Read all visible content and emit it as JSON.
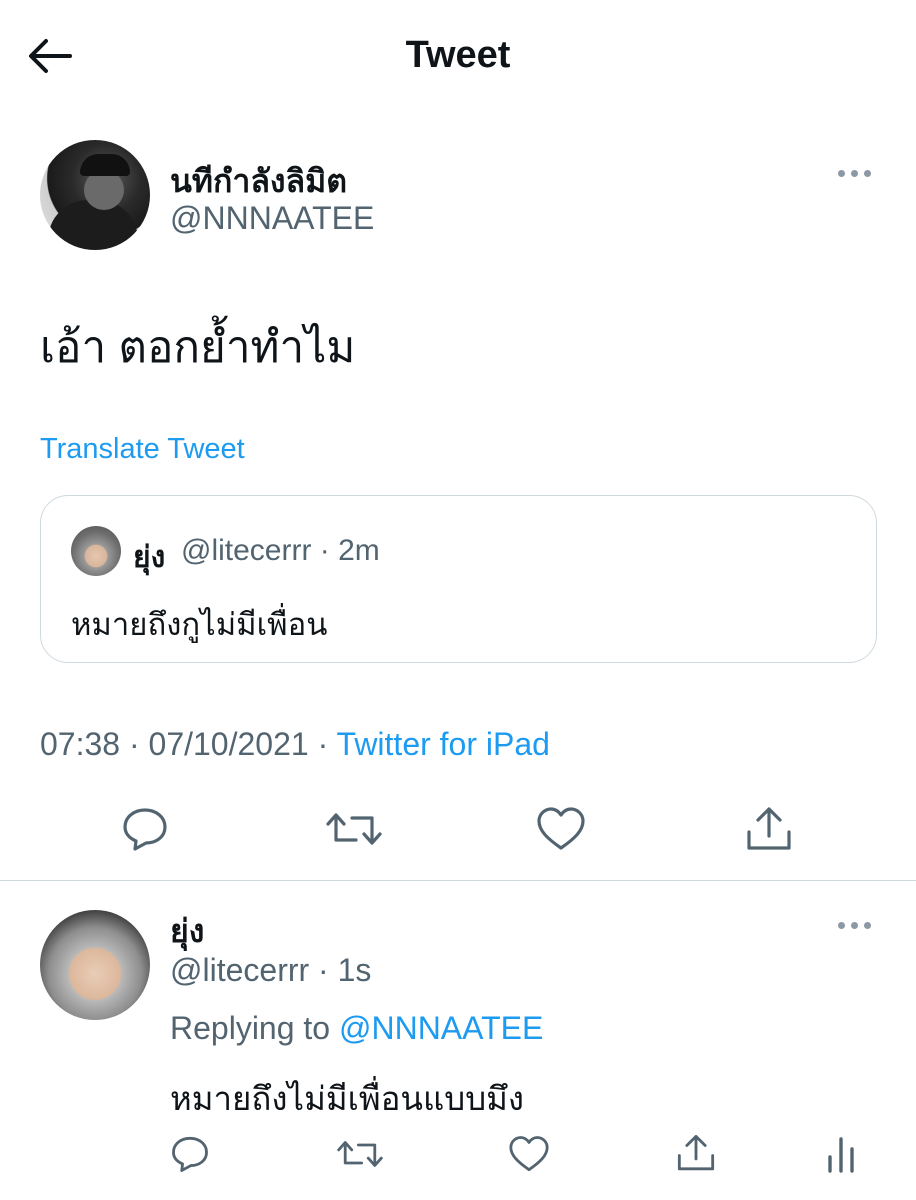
{
  "header": {
    "title": "Tweet"
  },
  "main_tweet": {
    "display_name": "นทีกำลังลิมิต",
    "handle": "@NNNAATEE",
    "text": "เอ้า ตอกย้ำทำไม",
    "translate_label": "Translate Tweet"
  },
  "quoted_tweet": {
    "display_name": "ยุ่ง",
    "handle_time": "@litecerrr · 2m",
    "text": "หมายถึงกูไม่มีเพื่อน"
  },
  "meta": {
    "time_date": "07:38 · 07/10/2021 · ",
    "source": "Twitter for iPad"
  },
  "reply_tweet": {
    "display_name": "ยุ่ง",
    "handle_time": "@litecerrr · 1s",
    "replying_prefix": "Replying to ",
    "replying_to": "@NNNAATEE",
    "text": "หมายถึงไม่มีเพื่อนแบบมึง"
  },
  "icons": {
    "back": "back-arrow-icon",
    "more": "more-horizontal-icon",
    "reply": "reply-icon",
    "retweet": "retweet-icon",
    "like": "like-icon",
    "share": "share-icon",
    "analytics": "analytics-icon"
  },
  "colors": {
    "accent": "#1d9bf0",
    "text": "#0f1419",
    "muted": "#536471",
    "icon": "#536471",
    "border": "#cfd9de"
  }
}
